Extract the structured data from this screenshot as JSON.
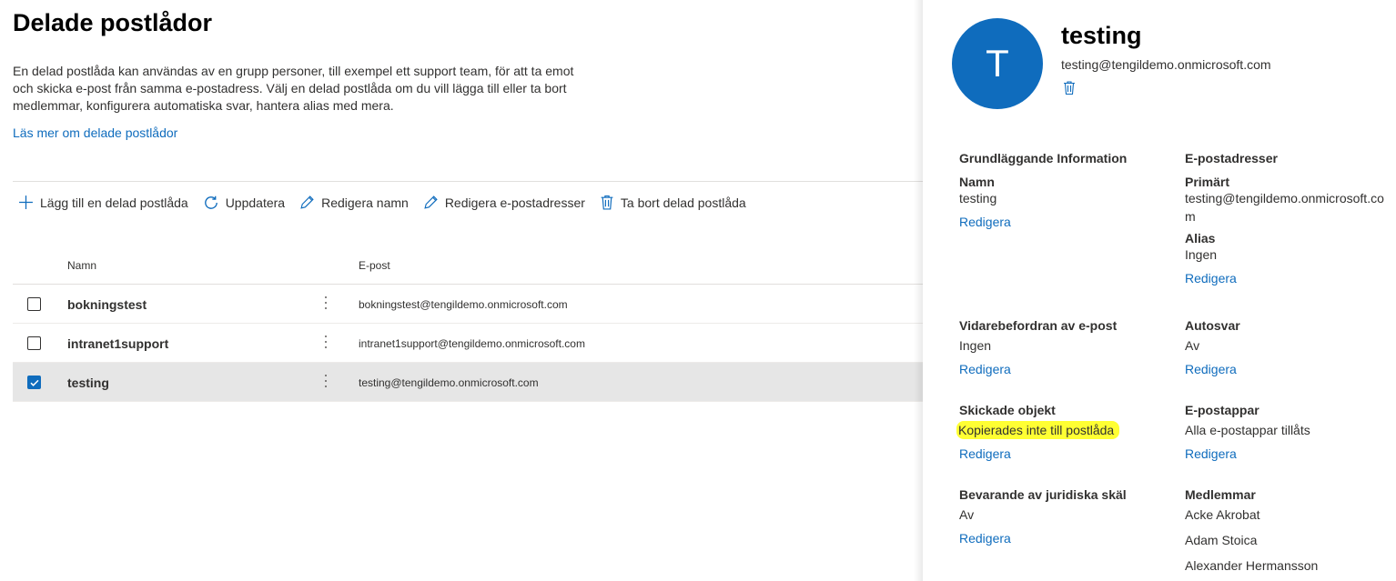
{
  "page": {
    "title": "Delade postlådor",
    "description": "En delad postlåda kan användas av en grupp personer, till exempel ett support team, för att ta emot och skicka e-post från samma e-postadress. Välj en delad postlåda om du vill lägga till eller ta bort medlemmar, konfigurera automatiska svar, hantera alias med mera.",
    "learn_more": "Läs mer om delade postlådor"
  },
  "toolbar": {
    "add": "Lägg till en delad postlåda",
    "refresh": "Uppdatera",
    "edit_name": "Redigera namn",
    "edit_emails": "Redigera e-postadresser",
    "delete": "Ta bort delad postlåda"
  },
  "table": {
    "columns": {
      "name": "Namn",
      "email": "E-post"
    },
    "rows": [
      {
        "name": "bokningstest",
        "email": "bokningstest@tengildemo.onmicrosoft.com",
        "checked": false
      },
      {
        "name": "intranet1support",
        "email": "intranet1support@tengildemo.onmicrosoft.com",
        "checked": false
      },
      {
        "name": "testing",
        "email": "testing@tengildemo.onmicrosoft.com",
        "checked": true
      }
    ]
  },
  "panel": {
    "avatar_letter": "T",
    "title": "testing",
    "email": "testing@tengildemo.onmicrosoft.com",
    "edit_label": "Redigera",
    "basic_info": {
      "heading": "Grundläggande Information",
      "name_label": "Namn",
      "name_value": "testing"
    },
    "email_addresses": {
      "heading": "E-postadresser",
      "primary_label": "Primärt",
      "primary_value": "testing@tengildemo.onmicrosoft.com",
      "alias_label": "Alias",
      "alias_value": "Ingen"
    },
    "forwarding": {
      "heading": "Vidarebefordran av e-post",
      "value": "Ingen"
    },
    "autoreply": {
      "heading": "Autosvar",
      "value": "Av"
    },
    "sent_items": {
      "heading": "Skickade objekt",
      "value": "Kopierades inte till postlåda"
    },
    "email_apps": {
      "heading": "E-postappar",
      "value": "Alla e-postappar tillåts"
    },
    "litigation_hold": {
      "heading": "Bevarande av juridiska skäl",
      "value": "Av"
    },
    "members": {
      "heading": "Medlemmar",
      "list": [
        "Acke Akrobat",
        "Adam Stoica",
        "Alexander Hermansson"
      ]
    }
  },
  "colors": {
    "accent": "#0f6cbd",
    "highlight": "#ffff33",
    "selected_row": "#e6e6e6"
  }
}
